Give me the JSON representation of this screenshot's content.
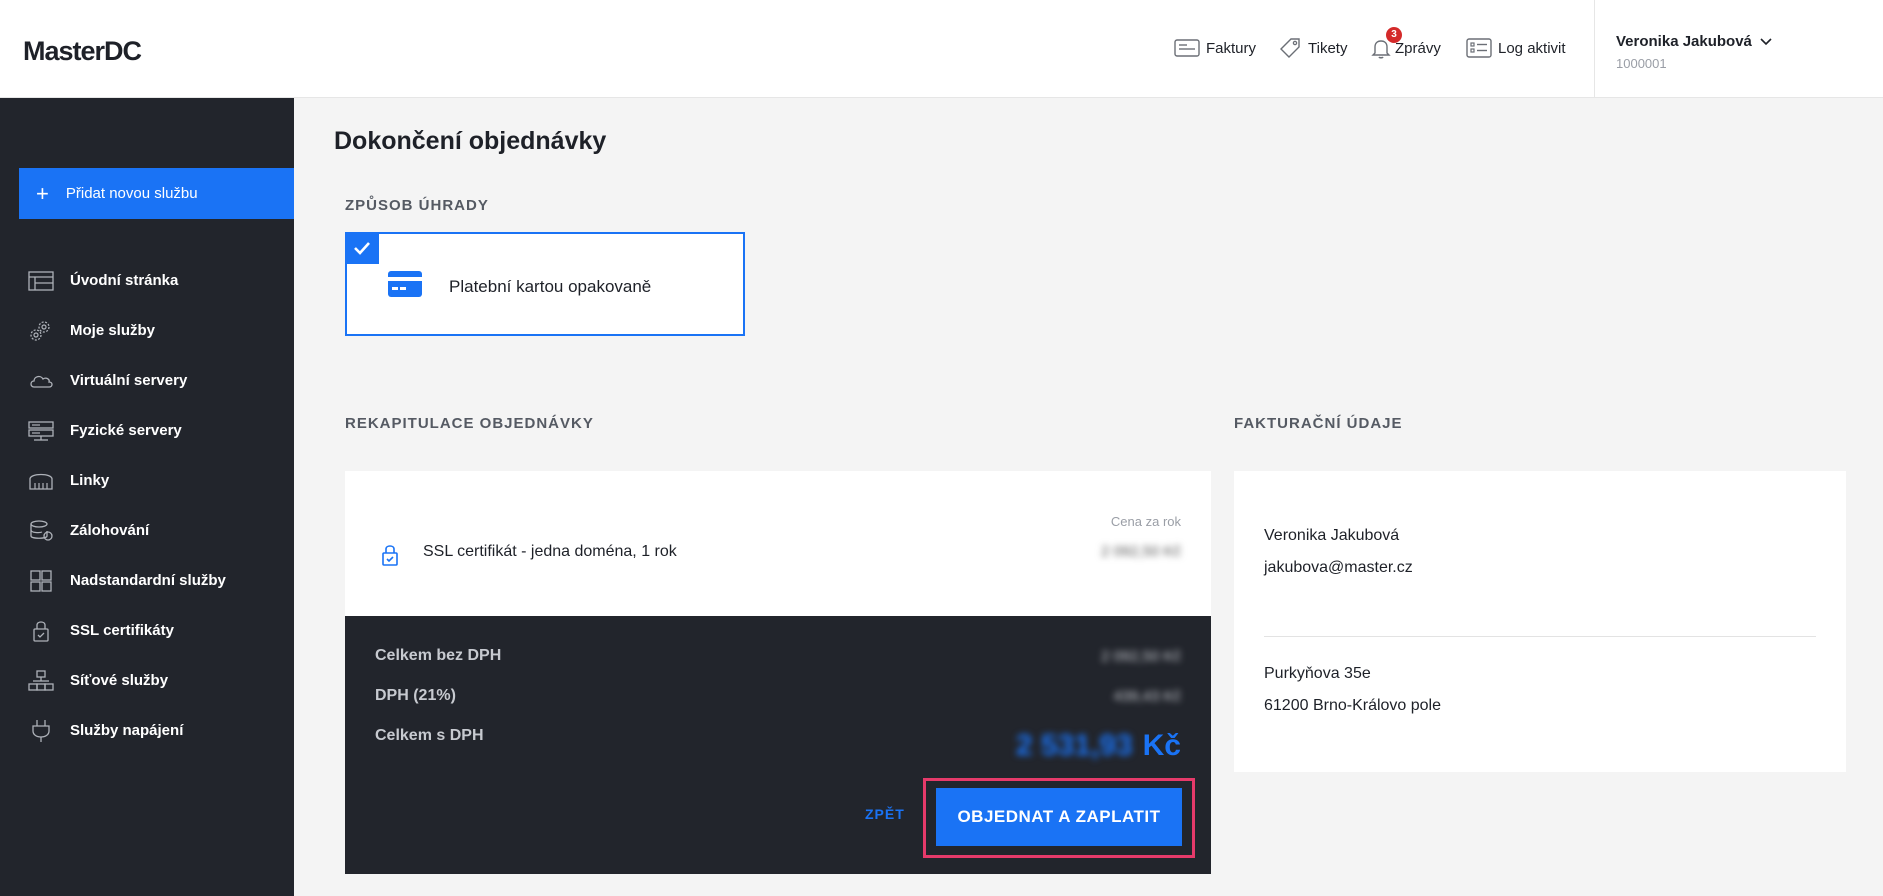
{
  "header": {
    "logo": "MasterDC",
    "nav": {
      "invoices": "Faktury",
      "tickets": "Tikety",
      "messages": "Zprávy",
      "messages_badge": "3",
      "activity_log": "Log aktivit"
    },
    "user": {
      "name": "Veronika Jakubová",
      "id": "1000001"
    }
  },
  "sidebar": {
    "add_service": "Přidat novou službu",
    "items": [
      {
        "label": "Úvodní stránka",
        "icon": "dashboard-icon"
      },
      {
        "label": "Moje služby",
        "icon": "gears-icon"
      },
      {
        "label": "Virtuální servery",
        "icon": "cloud-icon"
      },
      {
        "label": "Fyzické servery",
        "icon": "server-icon"
      },
      {
        "label": "Linky",
        "icon": "network-icon"
      },
      {
        "label": "Zálohování",
        "icon": "backup-icon"
      },
      {
        "label": "Nadstandardní služby",
        "icon": "grid-icon"
      },
      {
        "label": "SSL certifikáty",
        "icon": "lock-icon"
      },
      {
        "label": "Síťové služby",
        "icon": "network-services-icon"
      },
      {
        "label": "Služby napájení",
        "icon": "power-plug-icon"
      }
    ]
  },
  "main": {
    "title": "Dokončení objednávky",
    "payment": {
      "section_label": "ZPŮSOB ÚHRADY",
      "method": "Platební kartou opakovaně"
    },
    "order": {
      "section_label": "REKAPITULACE OBJEDNÁVKY",
      "price_header": "Cena za rok",
      "item_name": "SSL certifikát - jedna doména, 1 rok",
      "item_price": "2 092,50 Kč",
      "subtotal_label": "Celkem bez DPH",
      "subtotal_value": "2 092,50 Kč",
      "vat_label": "DPH (21%)",
      "vat_value": "439,43 Kč",
      "total_label": "Celkem s DPH",
      "total_value": "2 531,93",
      "currency": "Kč",
      "back_label": "ZPĚT",
      "order_button": "OBJEDNAT A ZAPLATIT"
    },
    "billing": {
      "section_label": "FAKTURAČNÍ ÚDAJE",
      "name": "Veronika Jakubová",
      "email": "jakubova@master.cz",
      "street": "Purkyňova 35e",
      "city": "61200 Brno-Královo pole"
    }
  },
  "colors": {
    "accent": "#1a73f5",
    "sidebar_bg": "#22252c",
    "highlight_frame": "#e63a6a",
    "badge": "#d42a2a"
  }
}
